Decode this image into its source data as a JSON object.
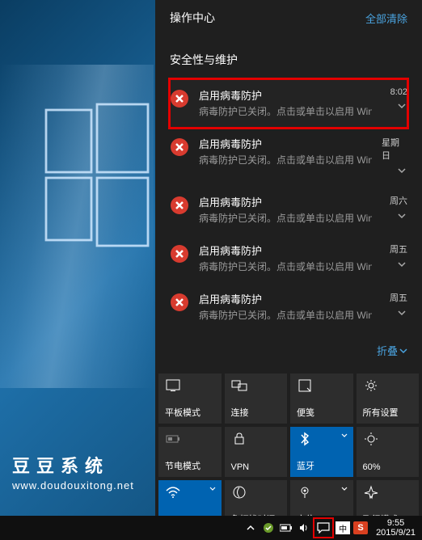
{
  "watermark": {
    "title": "豆豆系统",
    "url": "www.doudouxitong.net"
  },
  "action_center": {
    "header": "操作中心",
    "clear_all": "全部清除",
    "section_title": "安全性与维护",
    "collapse": "折叠",
    "notifications": [
      {
        "title": "启用病毒防护",
        "desc": "病毒防护已关闭。点击或单击以启用 Win",
        "time": "8:02",
        "highlighted": true
      },
      {
        "title": "启用病毒防护",
        "desc": "病毒防护已关闭。点击或单击以启用 Win",
        "time": "星期日",
        "highlighted": false
      },
      {
        "title": "启用病毒防护",
        "desc": "病毒防护已关闭。点击或单击以启用 Win",
        "time": "周六",
        "highlighted": false
      },
      {
        "title": "启用病毒防护",
        "desc": "病毒防护已关闭。点击或单击以启用 Win",
        "time": "周五",
        "highlighted": false
      },
      {
        "title": "启用病毒防护",
        "desc": "病毒防护已关闭。点击或单击以启用 Win",
        "time": "周五",
        "highlighted": false
      }
    ],
    "quick_actions": [
      {
        "id": "tablet",
        "label": "平板模式",
        "active": false,
        "chevron": false
      },
      {
        "id": "connect",
        "label": "连接",
        "active": false,
        "chevron": false
      },
      {
        "id": "note",
        "label": "便笺",
        "active": false,
        "chevron": false
      },
      {
        "id": "settings",
        "label": "所有设置",
        "active": false,
        "chevron": false
      },
      {
        "id": "battery",
        "label": "节电模式",
        "active": false,
        "chevron": false
      },
      {
        "id": "vpn",
        "label": "VPN",
        "active": false,
        "chevron": false
      },
      {
        "id": "bluetooth",
        "label": "蓝牙",
        "active": true,
        "chevron": true
      },
      {
        "id": "brightness",
        "label": "60%",
        "active": false,
        "chevron": false
      },
      {
        "id": "wifi",
        "label": "",
        "active": true,
        "chevron": true
      },
      {
        "id": "quiet",
        "label": "免打扰时间",
        "active": false,
        "chevron": false
      },
      {
        "id": "location",
        "label": "定位",
        "active": false,
        "chevron": true
      },
      {
        "id": "airplane",
        "label": "飞行模式",
        "active": false,
        "chevron": false
      }
    ]
  },
  "taskbar": {
    "ime": "中",
    "sogou": "S",
    "time": "9:55",
    "date": "2015/9/21"
  }
}
